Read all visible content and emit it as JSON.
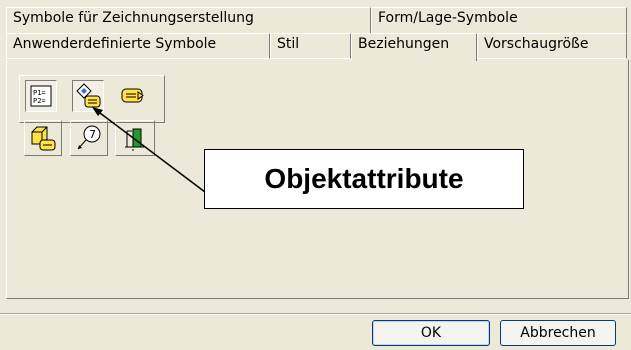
{
  "tabs": {
    "back_row": [
      {
        "label": "Symbole für Zeichnungserstellung"
      },
      {
        "label": "Form/Lage-Symbole"
      }
    ],
    "front_row": [
      {
        "label": "Anwenderdefinierte Symbole"
      },
      {
        "label": "Stil"
      },
      {
        "label": "Beziehungen",
        "selected": true
      },
      {
        "label": "Vorschaugröße"
      }
    ]
  },
  "toolbar": {
    "row1": [
      {
        "icon": "p1-p2-parameter-icon",
        "text": "P1=\nP2=",
        "pressed": true
      },
      {
        "icon": "object-attributes-icon",
        "pressed": true
      },
      {
        "icon": "text-note-icon",
        "pressed": false
      }
    ],
    "row2": [
      {
        "icon": "box-attributes-icon"
      },
      {
        "icon": "balloon-leader-icon",
        "text": "7"
      },
      {
        "icon": "section-symbol-icon"
      }
    ]
  },
  "callout": {
    "text": "Objektattribute"
  },
  "buttons": {
    "ok": "OK",
    "cancel": "Abbrechen"
  },
  "colors": {
    "dialog_bg": "#ece9d8",
    "button_border": "#003c74"
  }
}
